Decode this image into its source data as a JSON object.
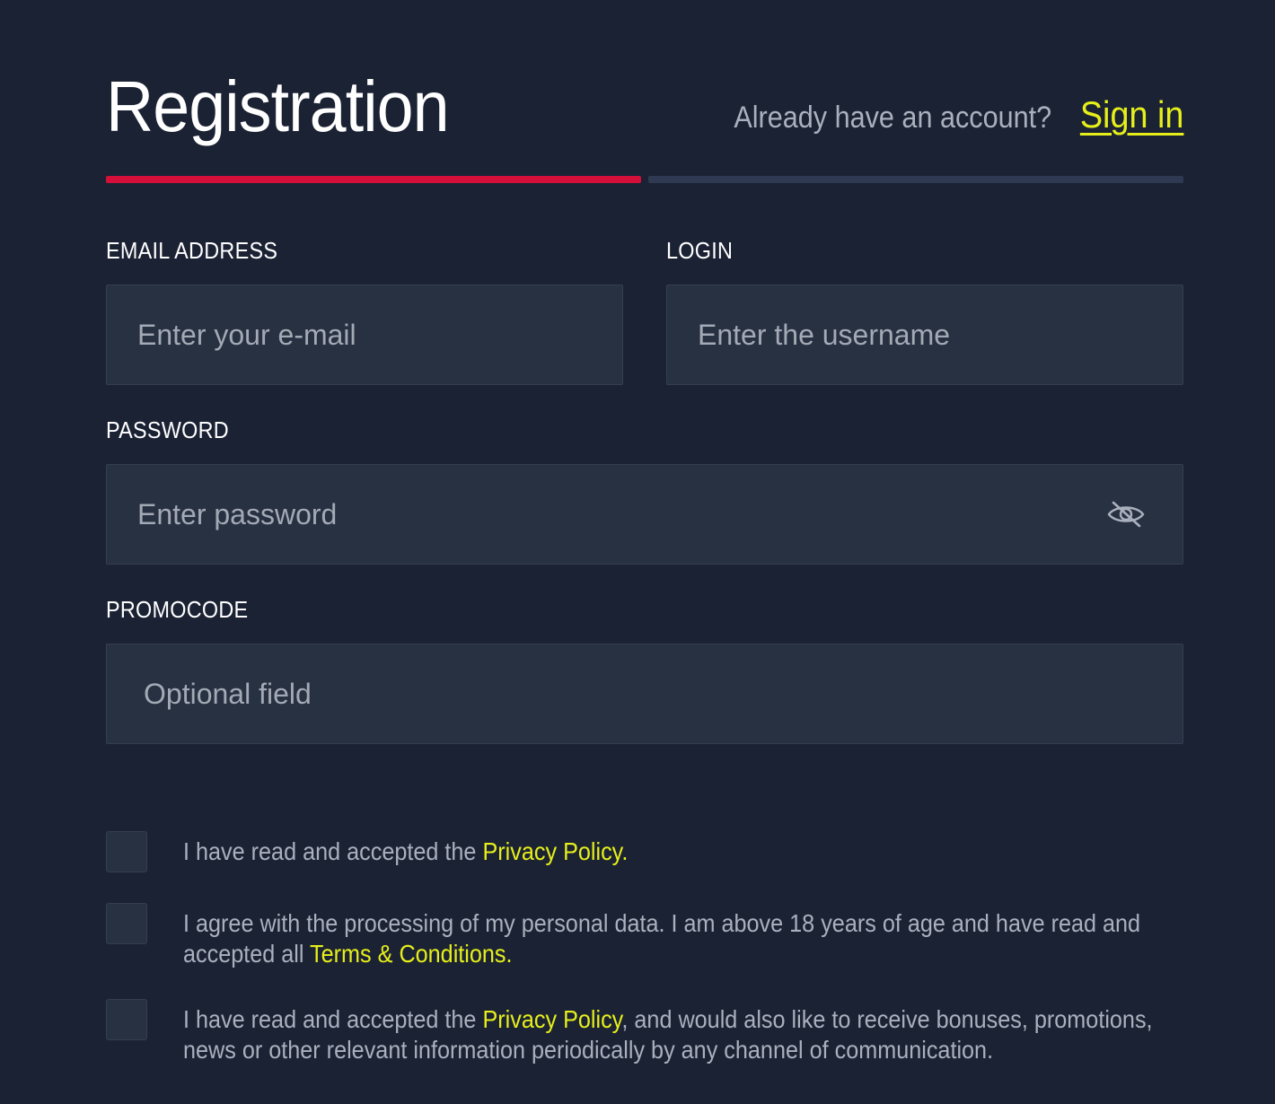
{
  "header": {
    "title": "Registration",
    "account_prompt": "Already have an account?",
    "signin_label": "Sign in"
  },
  "progress": {
    "steps_total": 2,
    "current_step": 1,
    "active_color": "#d4103a",
    "inactive_color": "#2f3a52"
  },
  "fields": {
    "email": {
      "label": "EMAIL ADDRESS",
      "placeholder": "Enter your e-mail",
      "value": ""
    },
    "login": {
      "label": "LOGIN",
      "placeholder": "Enter the username",
      "value": ""
    },
    "password": {
      "label": "PASSWORD",
      "placeholder": "Enter password",
      "value": "",
      "toggle_icon": "eye-slash-icon"
    },
    "promocode": {
      "label": "PROMOCODE",
      "placeholder": "Optional field",
      "value": ""
    }
  },
  "checkboxes": [
    {
      "checked": false,
      "text_before": "I have read and accepted the",
      "link_label": "Privacy Policy.",
      "text_after": ""
    },
    {
      "checked": false,
      "text_before": "I agree with the processing of my personal data. I am above 18 years of age and have read and accepted all",
      "link_label": "Terms & Conditions.",
      "text_after": ""
    },
    {
      "checked": false,
      "text_before": "I have read and accepted the",
      "link_label": "Privacy Policy",
      "text_after": ", and would also like to receive bonuses, promotions, news or other relevant information periodically by any channel of communication."
    }
  ],
  "colors": {
    "background": "#1b2234",
    "input_background": "#283142",
    "link": "#e6ef1a",
    "muted_text": "#aab0bd"
  }
}
